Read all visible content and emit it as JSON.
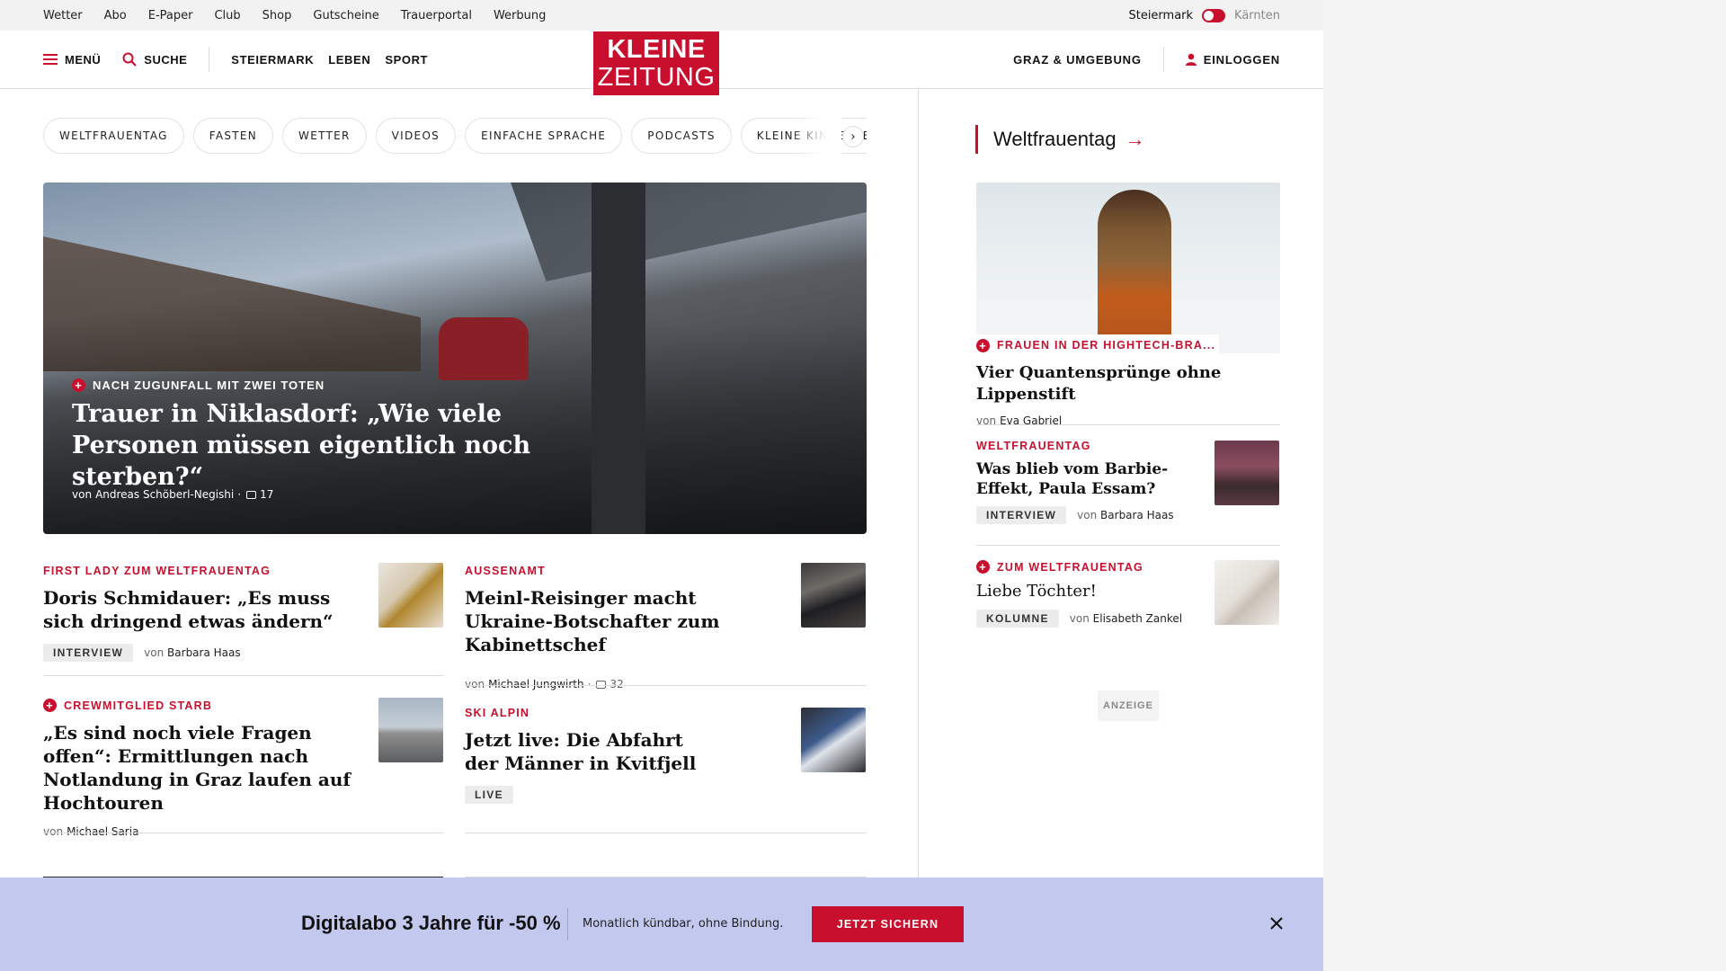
{
  "topbar": {
    "links": [
      "Wetter",
      "Abo",
      "E-Paper",
      "Club",
      "Shop",
      "Gutscheine",
      "Trauerportal",
      "Werbung"
    ],
    "region_active": "Steiermark",
    "region_inactive": "Kärnten"
  },
  "header": {
    "menu_label": "MENÜ",
    "search_label": "SUCHE",
    "nav": [
      "STEIERMARK",
      "LEBEN",
      "SPORT"
    ],
    "logo_line1": "KLEINE",
    "logo_line2": "ZEITUNG",
    "region_link": "GRAZ & UMGEBUNG",
    "login_label": "EINLOGGEN"
  },
  "topics": [
    "WELTFRAUENTAG",
    "FASTEN",
    "WETTER",
    "VIDEOS",
    "EINFACHE SPRACHE",
    "PODCASTS",
    "KLEINE KINDERZE"
  ],
  "hero": {
    "kicker": "NACH ZUGUNFALL MIT ZWEI TOTEN",
    "title": "Trauer in Niklasdorf: „Wie viele Personen müssen eigentlich noch sterben?“",
    "author_prefix": "von",
    "author": "Andreas Schöberl-Negishi",
    "comments": "17"
  },
  "articles": [
    {
      "kicker": "FIRST LADY ZUM WELTFRAUENTAG",
      "title": "Doris Schmidauer: „Es muss sich dringend etwas ändern“",
      "badge": "INTERVIEW",
      "author_prefix": "von",
      "author": "Barbara Haas"
    },
    {
      "kicker": "AUSSENAMT",
      "title": "Meinl-Reisinger macht Ukraine-Botschafter zum Kabinettschef",
      "author_prefix": "von",
      "author": "Michael Jungwirth",
      "comments": "32"
    },
    {
      "kicker": "CREWMITGLIED STARB",
      "title": "„Es sind noch viele Fragen offen“: Ermittlungen nach Notlandung in Graz laufen auf Hochtouren",
      "author_prefix": "von",
      "author": "Michael Saria"
    },
    {
      "kicker": "SKI ALPIN",
      "title": "Jetzt live: Die Abfahrt der Männer in Kvitfjell",
      "badge": "LIVE"
    }
  ],
  "sidebar": {
    "heading": "Weltfrauentag",
    "main": {
      "kicker": "FRAUEN IN DER HIGHTECH-BRA...",
      "title": "Vier Quantensprünge ohne Lippenstift",
      "author_prefix": "von",
      "author": "Eva Gabriel"
    },
    "items": [
      {
        "kicker": "WELTFRAUENTAG",
        "title": "Was blieb vom Barbie-Effekt, Paula Essam?",
        "badge": "INTERVIEW",
        "author_prefix": "von",
        "author": "Barbara Haas"
      },
      {
        "kicker": "ZUM WELTFRAUENTAG",
        "title": "Liebe Töchter!",
        "badge": "KOLUMNE",
        "author_prefix": "von",
        "author": "Elisabeth Zankel"
      }
    ],
    "ad_label": "ANZEIGE"
  },
  "promo": {
    "headline": "Digitalabo 3 Jahre für -50 %",
    "subtext": "Monatlich kündbar, ohne Bindung.",
    "cta": "JETZT SICHERN"
  },
  "colors": {
    "brand_red": "#c8102e",
    "promo_bg": "#c3c8ef",
    "topbar_bg": "#f2f2f2"
  }
}
